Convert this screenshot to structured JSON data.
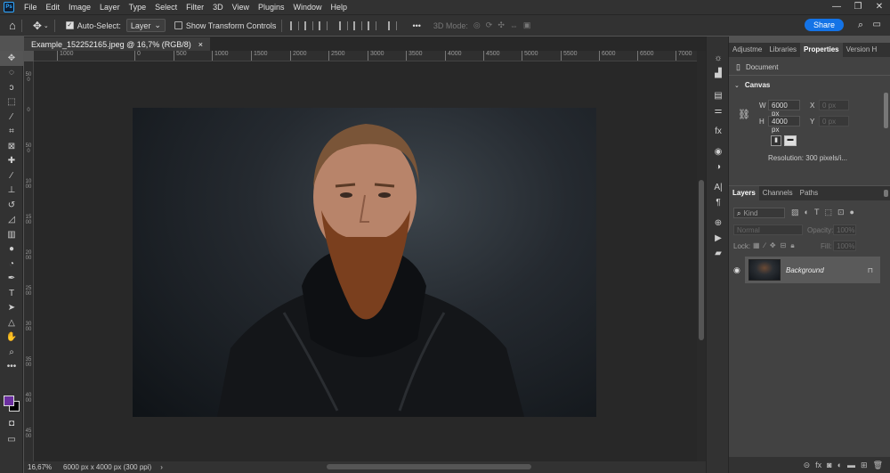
{
  "menubar": {
    "logo": "Ps",
    "items": [
      "File",
      "Edit",
      "Image",
      "Layer",
      "Type",
      "Select",
      "Filter",
      "3D",
      "View",
      "Plugins",
      "Window",
      "Help"
    ],
    "window_controls": [
      "minimize-icon",
      "restore-icon",
      "close-icon"
    ]
  },
  "options": {
    "auto_select_label": "Auto-Select:",
    "auto_select_target": "Layer",
    "show_transform_label": "Show Transform Controls",
    "mode_3d_label": "3D Mode:",
    "share_label": "Share",
    "more_label": "•••"
  },
  "document": {
    "tab_title": "Example_152252165.jpeg @ 16,7% (RGB/8)",
    "close": "×"
  },
  "ruler": {
    "top": [
      "1000",
      "0",
      "500",
      "1000",
      "1500",
      "2000",
      "2500",
      "3000",
      "3500",
      "4000",
      "4500",
      "5000",
      "5500",
      "6000",
      "6500",
      "7000"
    ],
    "left": [
      "500",
      "0",
      "500",
      "1000",
      "1500",
      "2000",
      "2500",
      "3000",
      "3500",
      "4000",
      "4500"
    ]
  },
  "status": {
    "zoom": "16,67%",
    "doc_info": "6000 px x 4000 px (300 ppi)",
    "arrow": "›"
  },
  "panel": {
    "tabs": [
      "Adjustme",
      "Libraries",
      "Properties",
      "Version H"
    ],
    "active_tab": "Properties",
    "doc_label": "Document",
    "canvas_heading": "Canvas",
    "w_label": "W",
    "w_value": "6000 px",
    "h_label": "H",
    "h_value": "4000 px",
    "x_label": "X",
    "x_value": "0 px",
    "y_label": "Y",
    "y_value": "0 px",
    "resolution": "Resolution: 300 pixels/i..."
  },
  "layers": {
    "tabs": [
      "Layers",
      "Channels",
      "Paths"
    ],
    "kind_placeholder": "Kind",
    "blend_mode": "Normal",
    "opacity_label": "Opacity:",
    "opacity_value": "100%",
    "lock_label": "Lock:",
    "fill_label": "Fill:",
    "fill_value": "100%",
    "items": [
      {
        "name": "Background"
      }
    ]
  },
  "colors": {
    "accent": "#1473e6",
    "foreground": "#6b2fa0",
    "background": "#000000"
  }
}
